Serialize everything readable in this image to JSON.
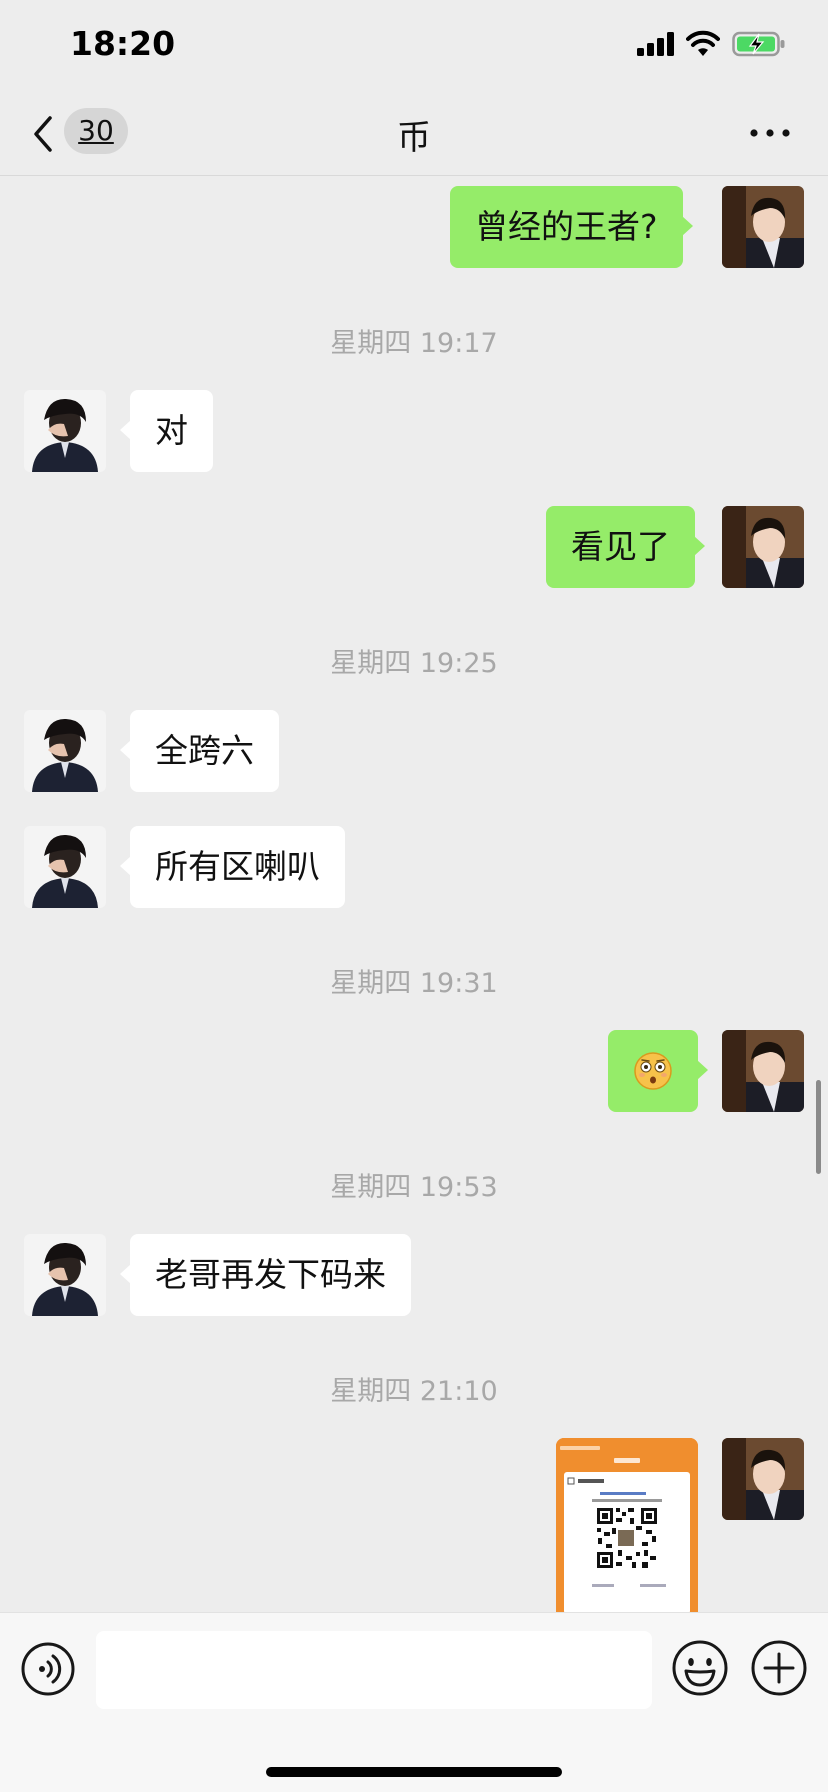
{
  "status_bar": {
    "time": "18:20",
    "signal_icon": "signal-icon",
    "wifi_icon": "wifi-icon",
    "battery_icon": "battery-charging-icon"
  },
  "nav": {
    "back_icon": "chevron-left-icon",
    "unread_count": "30",
    "title": "币",
    "more_icon": "more-horizontal-icon"
  },
  "messages": [
    {
      "type": "text",
      "direction": "outgoing",
      "text": "曾经的王者?"
    },
    {
      "type": "time",
      "text": "星期四 19:17"
    },
    {
      "type": "text",
      "direction": "incoming",
      "text": "对"
    },
    {
      "type": "text",
      "direction": "outgoing",
      "text": "看见了"
    },
    {
      "type": "time",
      "text": "星期四 19:25"
    },
    {
      "type": "text",
      "direction": "incoming",
      "text": "全跨六"
    },
    {
      "type": "text",
      "direction": "incoming",
      "text": "所有区喇叭"
    },
    {
      "type": "time",
      "text": "星期四 19:31"
    },
    {
      "type": "emoji",
      "direction": "outgoing",
      "emoji": "flushed-face-icon"
    },
    {
      "type": "time",
      "text": "星期四 19:53"
    },
    {
      "type": "text",
      "direction": "incoming",
      "text": "老哥再发下码来"
    },
    {
      "type": "time",
      "text": "星期四 21:10"
    },
    {
      "type": "image",
      "direction": "outgoing",
      "image": "payment-qr-code-screenshot"
    }
  ],
  "input_bar": {
    "voice_icon": "voice-icon",
    "input_value": "",
    "emoji_icon": "smiley-icon",
    "plus_icon": "plus-circle-icon"
  },
  "colors": {
    "background": "#ededed",
    "outgoing_bubble": "#95ec69",
    "incoming_bubble": "#ffffff",
    "timestamp_text": "#a8a8a8",
    "input_bar": "#f7f7f7"
  }
}
